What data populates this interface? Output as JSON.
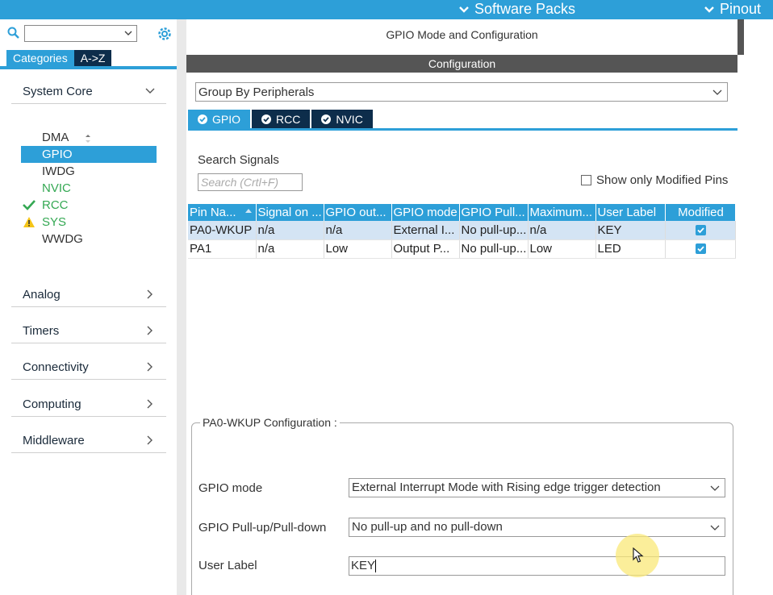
{
  "topbar": {
    "software_packs": "Software Packs",
    "pinout": "Pinout"
  },
  "left": {
    "search_value": "",
    "tabs": {
      "categories": "Categories",
      "az": "A->Z"
    },
    "sections": {
      "system_core": "System Core",
      "analog": "Analog",
      "timers": "Timers",
      "connectivity": "Connectivity",
      "computing": "Computing",
      "middleware": "Middleware"
    },
    "core_items": {
      "dma": "DMA",
      "gpio": "GPIO",
      "iwdg": "IWDG",
      "nvic": "NVIC",
      "rcc": "RCC",
      "sys": "SYS",
      "wwdg": "WWDG"
    }
  },
  "right": {
    "mode_title": "GPIO Mode and Configuration",
    "configuration": "Configuration",
    "group_by": "Group By Peripherals",
    "tabs": {
      "gpio": "GPIO",
      "rcc": "RCC",
      "nvic": "NVIC"
    },
    "search_signals_label": "Search Signals",
    "search_placeholder": "Search (Crtl+F)",
    "show_modified": "Show only Modified Pins",
    "table": {
      "headers": [
        "Pin Na...",
        "Signal on ...",
        "GPIO out...",
        "GPIO mode",
        "GPIO Pull...",
        "Maximum...",
        "User Label",
        "Modified"
      ],
      "rows": [
        [
          "PA0-WKUP",
          "n/a",
          "n/a",
          "External I...",
          "No pull-up...",
          "n/a",
          "KEY"
        ],
        [
          "PA1",
          "n/a",
          "Low",
          "Output P...",
          "No pull-up...",
          "Low",
          "LED"
        ]
      ]
    },
    "pin_config": {
      "legend": "PA0-WKUP Configuration :",
      "gpio_mode_label": "GPIO mode",
      "gpio_mode_value": "External Interrupt Mode with Rising edge trigger detection",
      "pull_label": "GPIO Pull-up/Pull-down",
      "pull_value": "No pull-up and no pull-down",
      "user_label_label": "User Label",
      "user_label_value": "KEY"
    }
  },
  "colors": {
    "accent": "#2d9fd8",
    "dark_tab": "#0d2d4b",
    "config_bar": "#555555",
    "selected_row": "#d4e4f4",
    "ok_green": "#34a853",
    "warn_yellow": "#f5c518"
  }
}
